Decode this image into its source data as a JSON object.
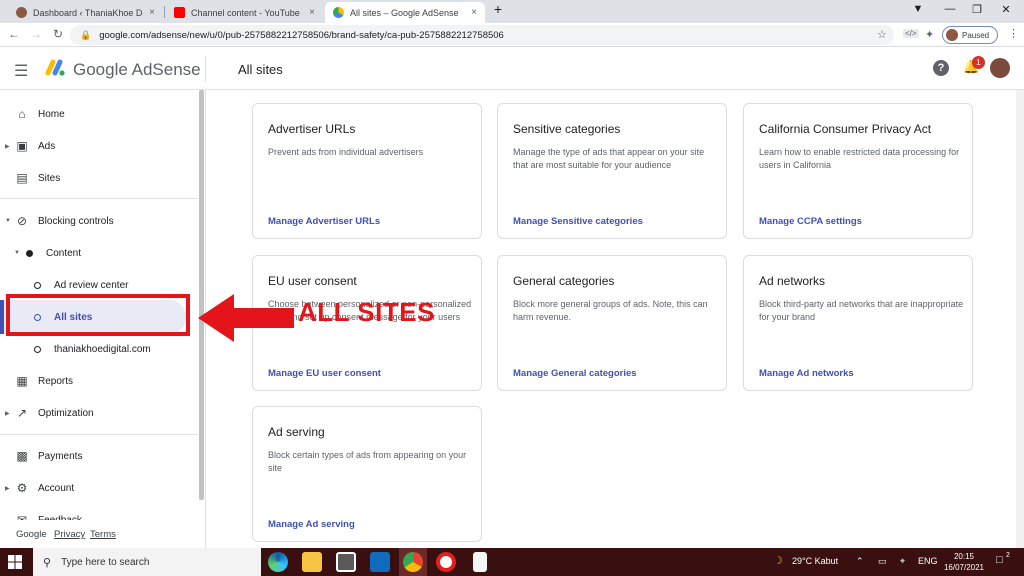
{
  "browser": {
    "tabs": [
      {
        "title": "Dashboard ‹ ThaniaKhoe Digital M",
        "close": "×"
      },
      {
        "title": "Channel content - YouTube Studio",
        "close": "×"
      },
      {
        "title": "All sites – Google AdSense",
        "close": "×"
      }
    ],
    "new_tab": "+",
    "url": "google.com/adsense/new/u/0/pub-2575882212758506/brand-safety/ca-pub-2575882212758506",
    "profile_status": "Paused"
  },
  "header": {
    "brand": "Google AdSense",
    "page_title": "All sites",
    "notification_count": "1"
  },
  "sidebar": {
    "items": [
      {
        "label": "Home"
      },
      {
        "label": "Ads"
      },
      {
        "label": "Sites"
      },
      {
        "label": "Blocking controls"
      },
      {
        "label": "Content"
      },
      {
        "label": "Ad review center"
      },
      {
        "label": "All sites"
      },
      {
        "label": "thaniakhoedigital.com"
      },
      {
        "label": "Reports"
      },
      {
        "label": "Optimization"
      },
      {
        "label": "Payments"
      },
      {
        "label": "Account"
      },
      {
        "label": "Feedback"
      }
    ],
    "footer": {
      "google": "Google",
      "privacy": "Privacy",
      "terms": "Terms"
    }
  },
  "cards": [
    {
      "title": "Advertiser URLs",
      "desc": "Prevent ads from individual advertisers",
      "link": "Manage Advertiser URLs"
    },
    {
      "title": "Sensitive categories",
      "desc": "Manage the type of ads that appear on your site that are most suitable for your audience",
      "link": "Manage Sensitive categories"
    },
    {
      "title": "California Consumer Privacy Act",
      "desc": "Learn how to enable restricted data processing for users in California",
      "link": "Manage CCPA settings"
    },
    {
      "title": "EU user consent",
      "desc": "Choose between personalized or non-personalized ads, and set up consent message for your users",
      "link": "Manage EU user consent"
    },
    {
      "title": "General categories",
      "desc": "Block more general groups of ads. Note, this can harm revenue.",
      "link": "Manage General categories"
    },
    {
      "title": "Ad networks",
      "desc": "Block third-party ad networks that are inappropriate for your brand",
      "link": "Manage Ad networks"
    },
    {
      "title": "Ad serving",
      "desc": "Block certain types of ads from appearing on your site",
      "link": "Manage Ad serving"
    }
  ],
  "annotation": {
    "text": "ALL SITES",
    "color": "#e3151a"
  },
  "taskbar": {
    "search_placeholder": "Type here to search",
    "weather": "29°C  Kabut",
    "language": "ENG",
    "time": "20:15",
    "date": "16/07/2021",
    "notifications": "2"
  },
  "colors": {
    "accent": "#3f51b5",
    "annotation": "#e3151a",
    "taskbar": "#3a0f0f"
  }
}
